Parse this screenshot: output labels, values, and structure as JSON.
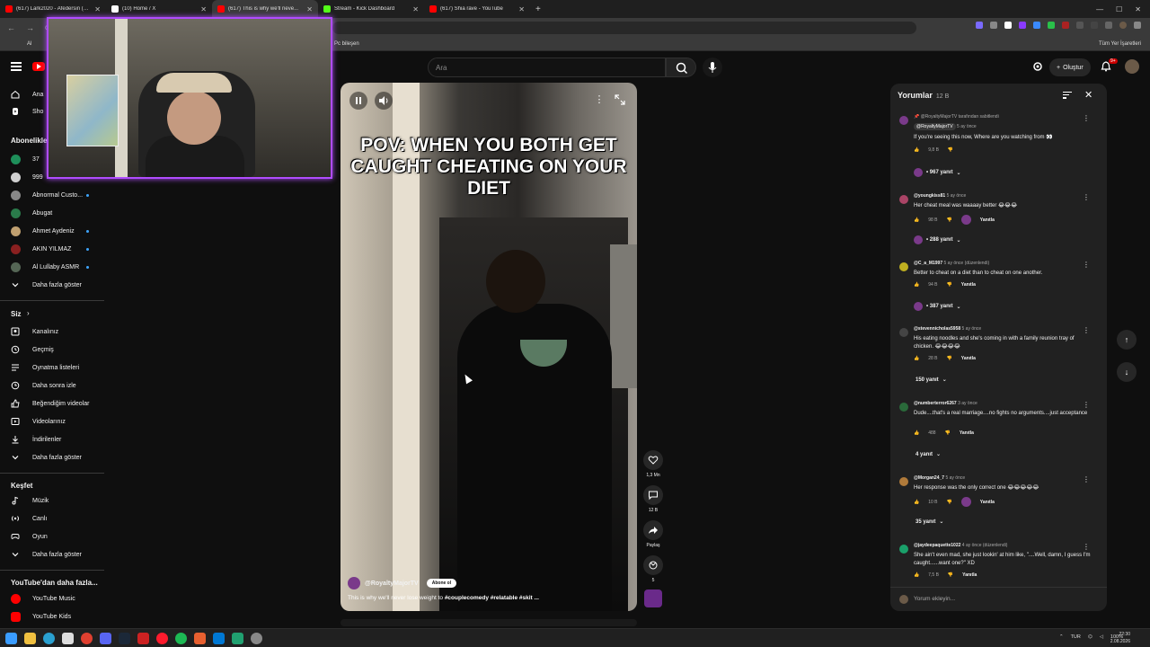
{
  "browser": {
    "tabs": [
      {
        "title": "(617) Lark2020 - Afedersin (Of...",
        "color": "#ff0000",
        "active": false
      },
      {
        "title": "(10) Home / X",
        "color": "#ffffff",
        "active": false
      },
      {
        "title": "(617) This is why we'll neve...",
        "color": "#ff0000",
        "active": true
      },
      {
        "title": "Stream - Kick Dashboard",
        "color": "#53fc18",
        "active": false
      },
      {
        "title": "(617) Shia rave - YouTube",
        "color": "#ff0000",
        "active": false
      }
    ],
    "new_tab": "+",
    "bookmark_left": "Al",
    "bookmark_mid": "Pc bileşen",
    "bookmark_right": "Tüm Yer İşaretleri"
  },
  "header": {
    "search_placeholder": "Ara",
    "create_label": "Oluştur",
    "notif_count": "9+"
  },
  "sidebar": {
    "top_items": [
      {
        "label": "Ana",
        "icon": "home-icon"
      },
      {
        "label": "Sho",
        "icon": "shorts-icon"
      }
    ],
    "subs_heading": "Abonelikle",
    "subscriptions": [
      {
        "label": "37",
        "color": "#1e8f5a",
        "dot": false
      },
      {
        "label": "999",
        "color": "#d0d0d0",
        "dot": false
      },
      {
        "label": "Abnormal Custo...",
        "color": "#888888",
        "dot": true
      },
      {
        "label": "Abugat",
        "color": "#2a7a4a",
        "dot": false
      },
      {
        "label": "Ahmet Aydeniz",
        "color": "#c0a070",
        "dot": true
      },
      {
        "label": "AKIN YILMAZ",
        "color": "#8a2020",
        "dot": true
      },
      {
        "label": "Al Lullaby ASMR",
        "color": "#556655",
        "dot": true
      }
    ],
    "subs_more": "Daha fazla göster",
    "you_heading": "Siz",
    "you_items": [
      {
        "label": "Kanalınız",
        "icon": "channel-icon"
      },
      {
        "label": "Geçmiş",
        "icon": "history-icon"
      },
      {
        "label": "Oynatma listeleri",
        "icon": "playlist-icon"
      },
      {
        "label": "Daha sonra izle",
        "icon": "clock-icon"
      },
      {
        "label": "Beğendiğim videolar",
        "icon": "like-icon"
      },
      {
        "label": "Videolarınız",
        "icon": "video-icon"
      },
      {
        "label": "İndirilenler",
        "icon": "download-icon"
      },
      {
        "label": "Daha fazla göster",
        "icon": "chevron-down-icon"
      }
    ],
    "explore_heading": "Keşfet",
    "explore_items": [
      {
        "label": "Müzik",
        "icon": "music-icon"
      },
      {
        "label": "Canlı",
        "icon": "live-icon"
      },
      {
        "label": "Oyun",
        "icon": "gaming-icon"
      },
      {
        "label": "Daha fazla göster",
        "icon": "chevron-down-icon"
      }
    ],
    "more_heading": "YouTube'dan daha fazla...",
    "more_items": [
      {
        "label": "YouTube Music",
        "color": "#ff0000"
      },
      {
        "label": "YouTube Kids",
        "color": "#ff0000"
      }
    ]
  },
  "video": {
    "caption": "POV: WHEN YOU BOTH GET CAUGHT CHEATING ON YOUR DIET",
    "channel": "@RoyaltyMajorTV",
    "subscribe_label": "Abone ol",
    "description_plain": "This is why we'll never lose weight to ",
    "description_tags": "#couplecomedy #relatable #skit ...",
    "likes": "1,3 Mn",
    "comments": "12 B",
    "share_label": "Paylaş",
    "remix_count": "5"
  },
  "comments_panel": {
    "title": "Yorumlar",
    "count": "12 B",
    "input_placeholder": "Yorum ekleyin...",
    "items": [
      {
        "pinned_by": "@RoyaltyMajorTV tarafından sabitlendi",
        "user": "@RoyaltyMajorTV",
        "time": "5 ay önce",
        "text": "If you're seeing this now, Where are you watching from 👀",
        "likes": "9,8 B",
        "replies": "• 967 yanıt",
        "avatar": "#7a3a8a",
        "has_reply_btn": false
      },
      {
        "user": "@youngkiss81",
        "time": "5 ay önce",
        "text": "Her cheat meal was waaaay better 😂😂😂",
        "likes": "98 B",
        "reply_label": "Yanıtla",
        "replies": "• 288 yanıt",
        "avatar": "#aa4466",
        "has_reply_btn": true
      },
      {
        "user": "@C_a_M1997",
        "time": "5 ay önce (düzenlendi)",
        "text": "Better to cheat on a diet than to cheat on one another.",
        "likes": "94 B",
        "reply_label": "Yanıtla",
        "replies": "• 387 yanıt",
        "avatar": "#c0b020",
        "has_reply_btn": true
      },
      {
        "user": "@stevennicholas5958",
        "time": "5 ay önce",
        "text": "His eating noodles and she's coming in with a family reunion tray of chicken. 😂😂😂😂",
        "likes": "28 B",
        "reply_label": "Yanıtla",
        "replies": "150 yanıt",
        "avatar": "#444444",
        "has_reply_btn": true
      },
      {
        "user": "@numberterror6267",
        "time": "3 ay önce",
        "text": "Dude....that's a real marriage....no fights no arguments....just acceptance",
        "likes": "488",
        "reply_label": "Yanıtla",
        "replies": "4 yanıt",
        "avatar": "#2a6a3a",
        "has_reply_btn": true
      },
      {
        "user": "@Morgan24_7",
        "time": "5 ay önce",
        "text": "Her response was the only correct one 😂😂😂😂😂",
        "likes": "10 B",
        "reply_label": "Yanıtla",
        "replies": "35 yanıt",
        "avatar": "#b07a3a",
        "has_reply_btn": true
      },
      {
        "user": "@jaydeepaquette1022",
        "time": "4 ay önce (düzenlendi)",
        "text": "She ain't even mad, she just lookin' at him like, \"....Well, damn, I guess I'm caught......want one?\" XD",
        "likes": "7,5 B",
        "reply_label": "Yanıtla",
        "avatar": "#1aa06a",
        "has_reply_btn": true
      }
    ]
  },
  "taskbar": {
    "lang": "TUR",
    "battery": "100%",
    "time": "22:30",
    "date": "2.08.2026"
  }
}
